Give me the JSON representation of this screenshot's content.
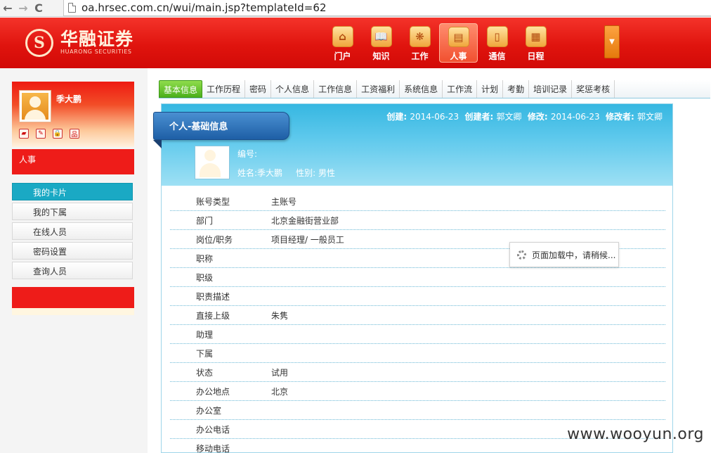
{
  "browser": {
    "url": "oa.hrsec.com.cn/wui/main.jsp?templateId=62",
    "back_glyph": "←",
    "forward_glyph": "→",
    "reload_glyph": "C"
  },
  "header": {
    "logo_mark": "S",
    "logo_cn": "华融证券",
    "logo_en": "HUARONG SECURITIES",
    "menu": [
      {
        "label": "门户",
        "icon": "home-icon",
        "glyph": "⌂"
      },
      {
        "label": "知识",
        "icon": "book-icon",
        "glyph": "📖"
      },
      {
        "label": "工作",
        "icon": "work-icon",
        "glyph": "❋"
      },
      {
        "label": "人事",
        "icon": "document-icon",
        "glyph": "▤"
      },
      {
        "label": "通信",
        "icon": "phone-icon",
        "glyph": "▯"
      },
      {
        "label": "日程",
        "icon": "calendar-icon",
        "glyph": "▦"
      }
    ],
    "more_glyph": "▼"
  },
  "sidebar": {
    "user_name": "季大鹏",
    "quick_icons": [
      {
        "name": "bookmark-icon",
        "glyph": "▰"
      },
      {
        "name": "edit-icon",
        "glyph": "✎"
      },
      {
        "name": "lock-icon",
        "glyph": "🔒"
      },
      {
        "name": "org-icon",
        "glyph": "品"
      }
    ],
    "module_title": "人事",
    "items": [
      {
        "label": "我的卡片"
      },
      {
        "label": "我的下属"
      },
      {
        "label": "在线人员"
      },
      {
        "label": "密码设置"
      },
      {
        "label": "查询人员"
      }
    ]
  },
  "tabs": [
    "基本信息",
    "工作历程",
    "密码",
    "个人信息",
    "工作信息",
    "工资福利",
    "系统信息",
    "工作流",
    "计划",
    "考勤",
    "培训记录",
    "奖惩考核"
  ],
  "card": {
    "title": "个人-基础信息",
    "meta": {
      "created_label": "创建:",
      "created": "2014-06-23",
      "creator_label": "创建者:",
      "creator": "郭文卿",
      "modified_label": "修改:",
      "modified": "2014-06-23",
      "modifier_label": "修改者:",
      "modifier": "郭文卿"
    },
    "code_line": "编号:",
    "name_line": "姓名:季大鹏     性别: 男性",
    "rows": [
      {
        "k": "账号类型",
        "v": "主账号"
      },
      {
        "k": "部门",
        "v": "北京金融街营业部"
      },
      {
        "k": "岗位/职务",
        "v": "项目经理/ 一般员工"
      },
      {
        "k": "职称",
        "v": ""
      },
      {
        "k": "职级",
        "v": ""
      },
      {
        "k": "职责描述",
        "v": ""
      },
      {
        "k": "直接上级",
        "v": "朱隽"
      },
      {
        "k": "助理",
        "v": ""
      },
      {
        "k": "下属",
        "v": ""
      },
      {
        "k": "状态",
        "v": "试用"
      },
      {
        "k": "办公地点",
        "v": "北京"
      },
      {
        "k": "办公室",
        "v": ""
      },
      {
        "k": "办公电话",
        "v": ""
      },
      {
        "k": "移动电话",
        "v": ""
      }
    ]
  },
  "loader": {
    "text": "页面加载中，请稍候..."
  },
  "watermark": "www.wooyun.org",
  "colors": {
    "header_red": "#e0140e",
    "active_blue": "#1aa9c4",
    "tab_green": "#4cb01c"
  }
}
